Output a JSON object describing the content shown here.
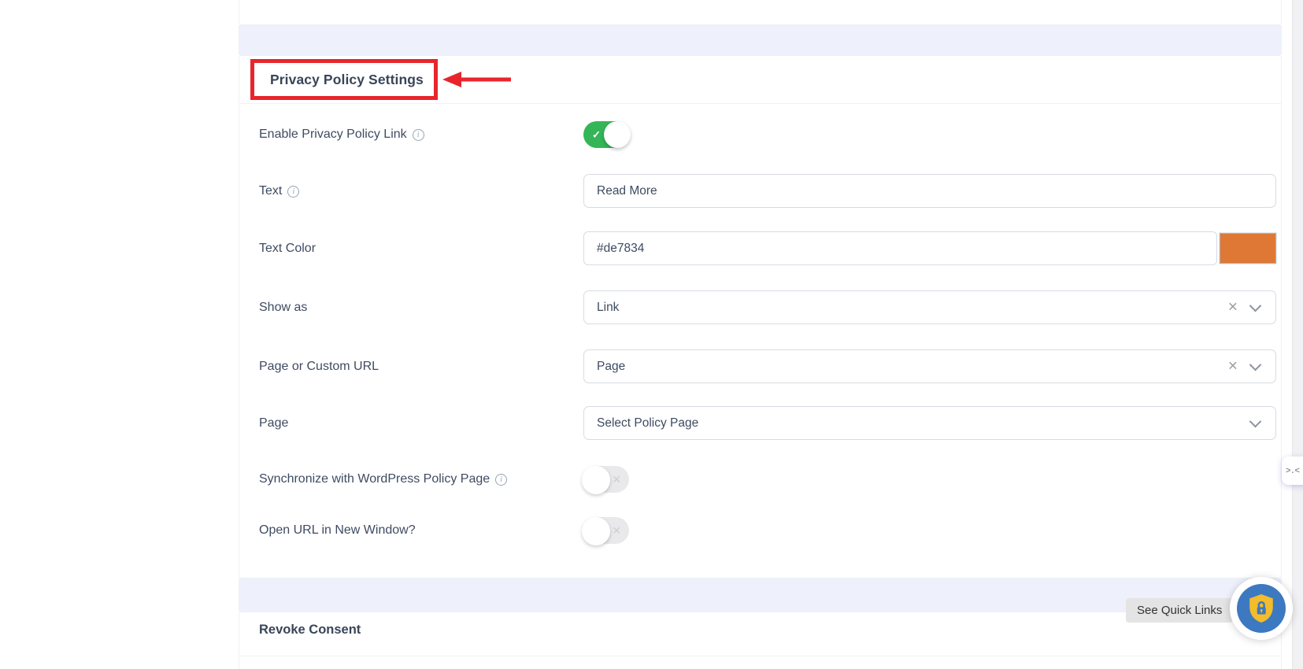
{
  "colors": {
    "annotation_red": "#e8252c",
    "toggle_on_green": "#35b558",
    "text_color_value": "#de7834",
    "shield_blue": "#3c79c0",
    "shield_gold": "#f2bc2b"
  },
  "icons": {
    "check": "✓",
    "cross": "✕",
    "clear": "×",
    "info": "i"
  },
  "sections": {
    "privacy": {
      "title": "Privacy Policy Settings",
      "rows": [
        {
          "id": "enable-privacy-policy-link",
          "label": "Enable Privacy Policy Link",
          "info": true,
          "control": "toggle",
          "state": "on"
        },
        {
          "id": "privacy-link-text",
          "label": "Text",
          "info": true,
          "control": "input",
          "value": "Read More"
        },
        {
          "id": "privacy-link-text-color",
          "label": "Text Color",
          "info": false,
          "control": "color",
          "value": "#de7834",
          "swatch": "#de7834"
        },
        {
          "id": "show-as",
          "label": "Show as",
          "info": false,
          "control": "select",
          "value": "Link",
          "clearable": true
        },
        {
          "id": "page-or-custom-url",
          "label": "Page or Custom URL",
          "info": false,
          "control": "select",
          "value": "Page",
          "clearable": true
        },
        {
          "id": "policy-page",
          "label": "Page",
          "info": false,
          "control": "select",
          "value": "Select Policy Page",
          "clearable": false
        },
        {
          "id": "sync-wordpress-policy-page",
          "label": "Synchronize with WordPress Policy Page",
          "info": true,
          "control": "toggle",
          "state": "off"
        },
        {
          "id": "open-url-new-window",
          "label": "Open URL in New Window?",
          "info": false,
          "control": "toggle",
          "state": "off"
        }
      ]
    },
    "revoke": {
      "title": "Revoke Consent"
    }
  },
  "floating": {
    "quick_links_label": "See Quick Links",
    "edge_widget_face": ">.<"
  }
}
